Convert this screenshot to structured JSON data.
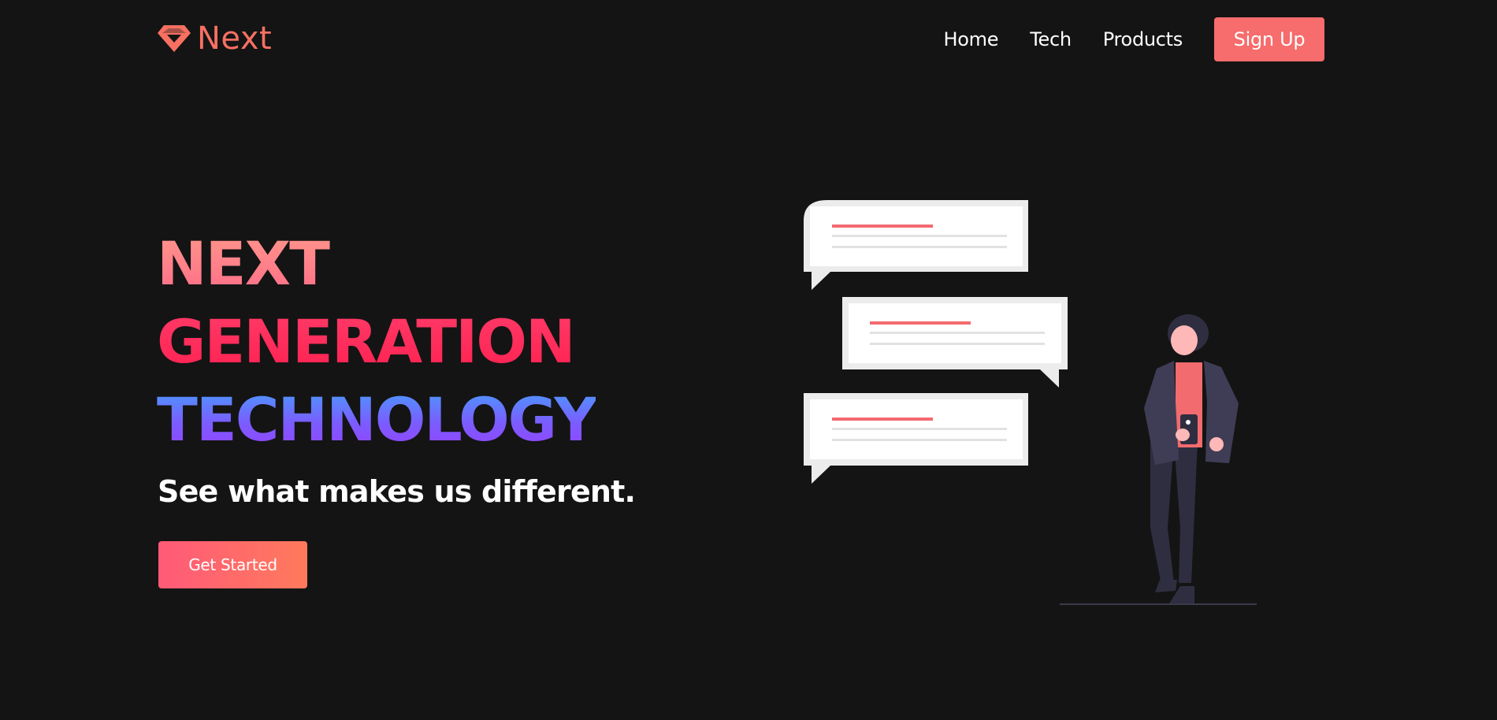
{
  "brand": {
    "name": "Next",
    "logo_icon": "diamond-icon",
    "accent_color": "#f77062"
  },
  "nav": {
    "links": [
      {
        "label": "Home"
      },
      {
        "label": "Tech"
      },
      {
        "label": "Products"
      }
    ],
    "signup_label": "Sign Up",
    "signup_color": "#f76c6c"
  },
  "hero": {
    "heading_lines": [
      "NEXT",
      "GENERATION",
      "TECHNOLOGY"
    ],
    "subtitle": "See what makes us different.",
    "cta_label": "Get Started"
  },
  "colors": {
    "background": "#141414",
    "heading_next": "#ff8a80",
    "heading_generation": "#ff1f4f",
    "heading_technology_start": "#3fa9ff",
    "heading_technology_end": "#9a3dff",
    "cta_start": "#ff5a78",
    "cta_end": "#ff7a5c"
  },
  "illustration": {
    "name": "chat-bubbles-person-illustration",
    "bubble_count": 3
  }
}
